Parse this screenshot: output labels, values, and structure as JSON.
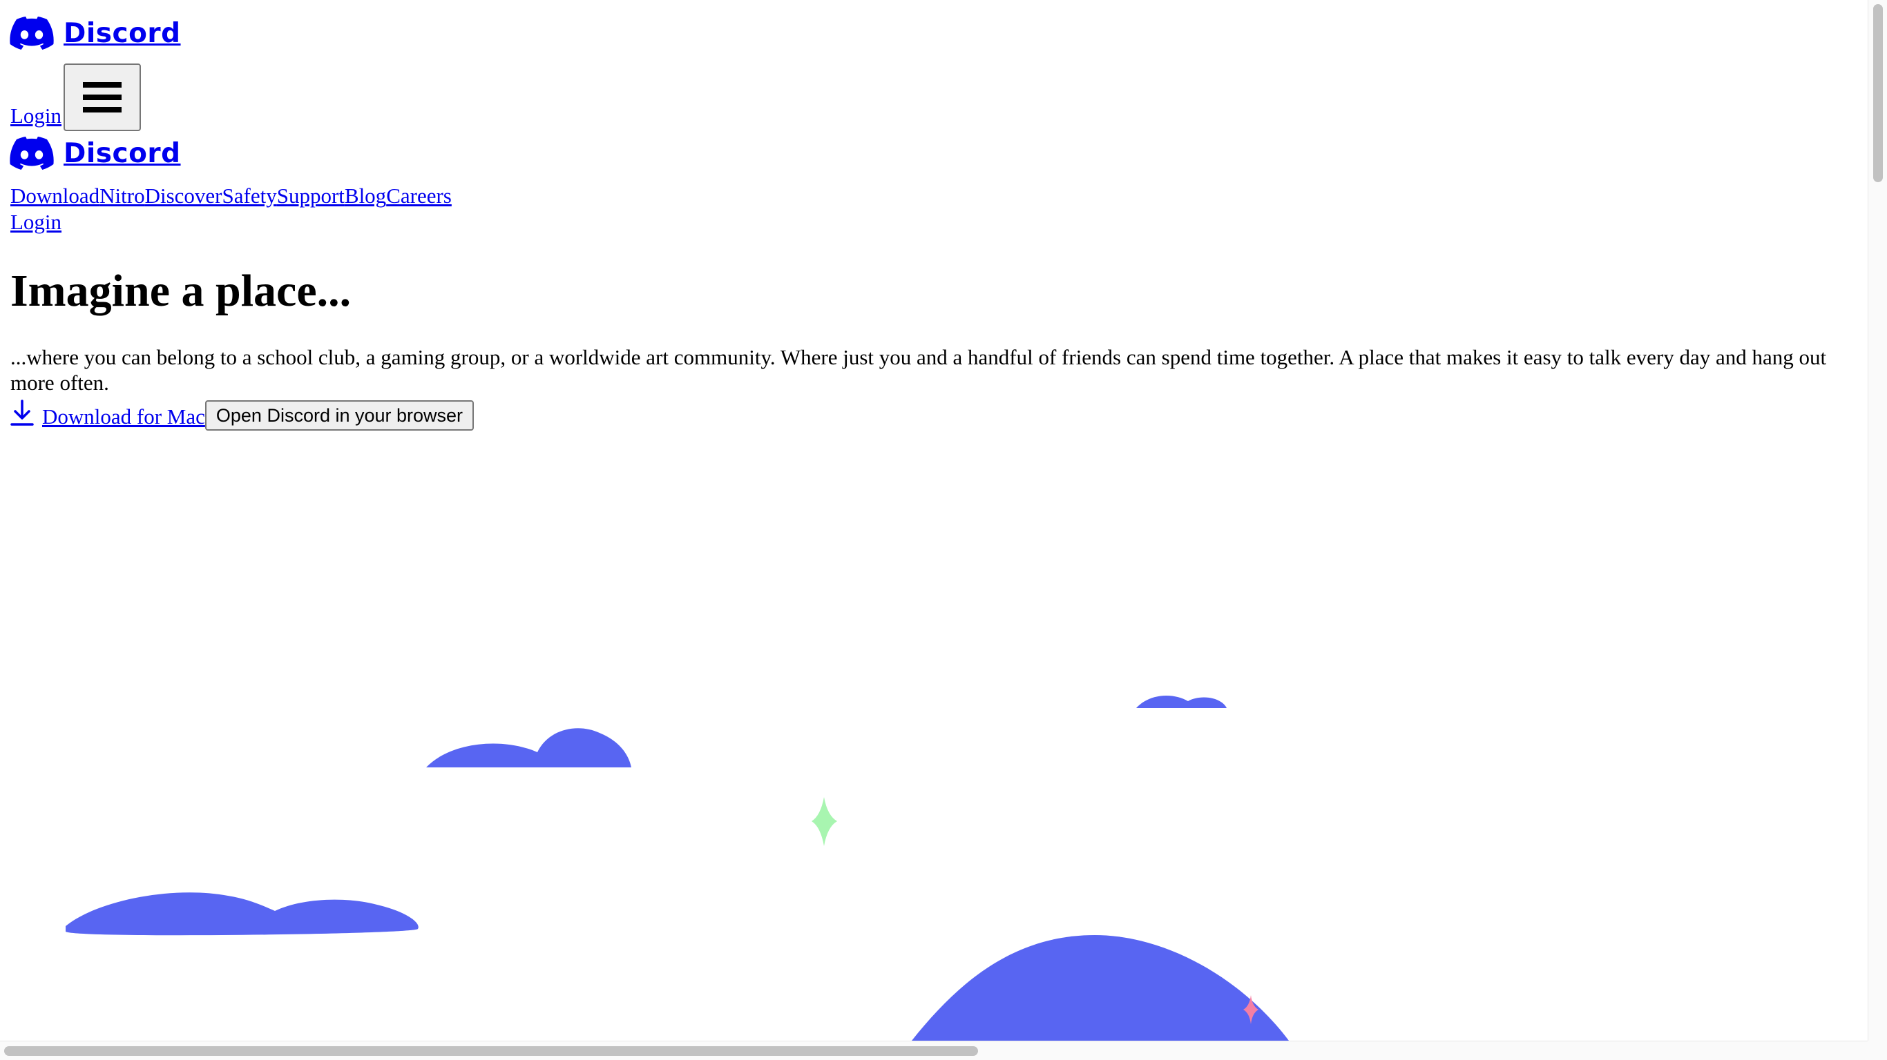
{
  "header": {
    "brand": "Discord",
    "login_label": "Login",
    "menu_icon": "hamburger-menu-icon"
  },
  "nav": {
    "brand": "Discord",
    "items": [
      {
        "label": "Download"
      },
      {
        "label": "Nitro"
      },
      {
        "label": "Discover"
      },
      {
        "label": "Safety"
      },
      {
        "label": "Support"
      },
      {
        "label": "Blog"
      },
      {
        "label": "Careers"
      }
    ],
    "login_label": "Login"
  },
  "hero": {
    "title": "Imagine a place...",
    "description": "...where you can belong to a school club, a gaming group, or a worldwide art community. Where just you and a handful of friends can spend time together. A place that makes it easy to talk every day and hang out more often.",
    "download_label": "Download for Mac",
    "download_icon": "download-icon",
    "browser_button_label": "Open Discord in your browser"
  },
  "colors": {
    "link": "#0000EE",
    "blurple": "#5865F2",
    "sparkle_green": "#A8F5B0",
    "sparkle_pink": "#F47FA4"
  }
}
